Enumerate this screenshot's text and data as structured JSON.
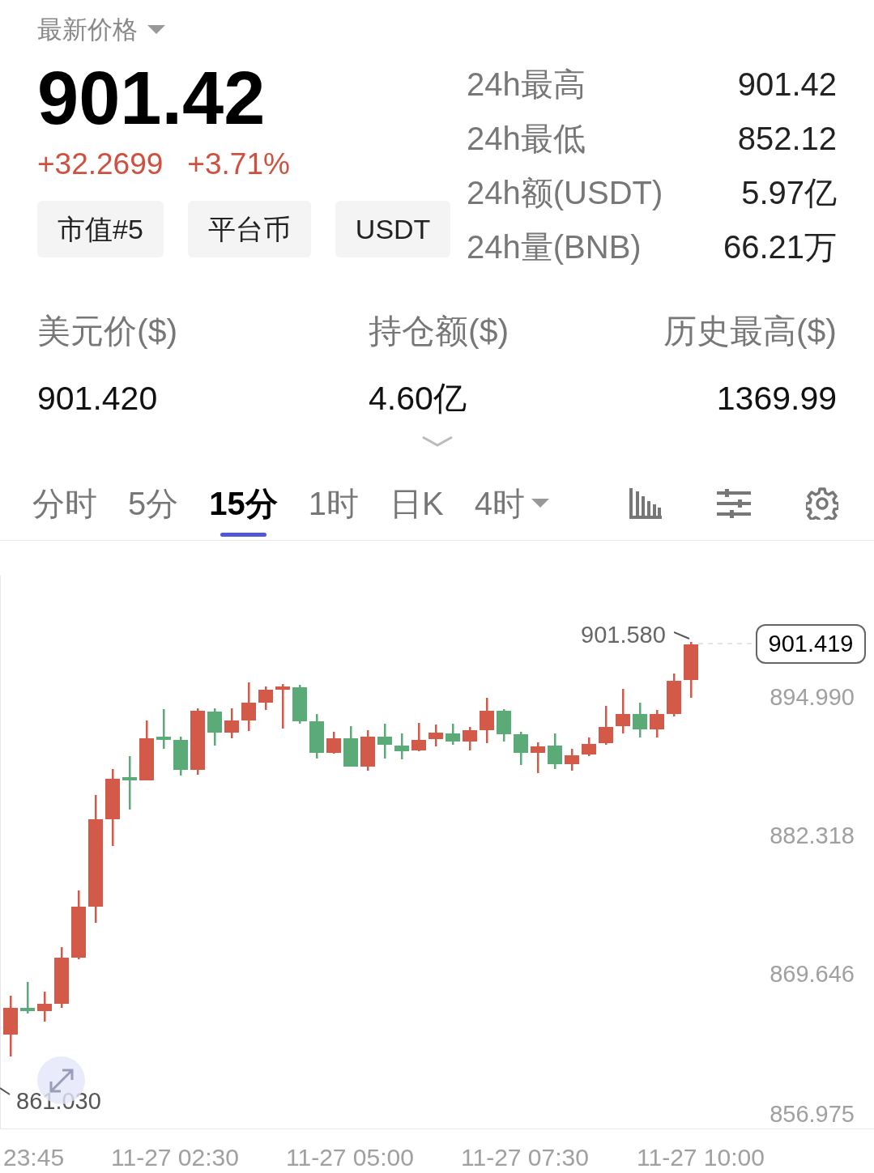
{
  "header": {
    "price_selector": "最新价格",
    "last_price": "901.42",
    "change": "+32.2699",
    "change_pct": "+3.71%",
    "tags": [
      "市值#5",
      "平台币",
      "USDT"
    ]
  },
  "stats_24h": [
    {
      "label": "24h最高",
      "value": "901.42"
    },
    {
      "label": "24h最低",
      "value": "852.12"
    },
    {
      "label": "24h额(USDT)",
      "value": "5.97亿"
    },
    {
      "label": "24h量(BNB)",
      "value": "66.21万"
    }
  ],
  "summary": [
    {
      "label": "美元价($)",
      "value": "901.420"
    },
    {
      "label": "持仓额($)",
      "value": "4.60亿"
    },
    {
      "label": "历史最高($)",
      "value": "1369.99"
    }
  ],
  "tabs": [
    {
      "label": "分时",
      "selected": false,
      "dropdown": false
    },
    {
      "label": "5分",
      "selected": false,
      "dropdown": false
    },
    {
      "label": "15分",
      "selected": true,
      "dropdown": false
    },
    {
      "label": "1时",
      "selected": false,
      "dropdown": false
    },
    {
      "label": "日K",
      "selected": false,
      "dropdown": false
    },
    {
      "label": "4时",
      "selected": false,
      "dropdown": true
    }
  ],
  "chart": {
    "y_axis_labels": [
      "894.990",
      "882.318",
      "869.646",
      "856.975"
    ],
    "current_price": "901.419",
    "high_marker": "901.580",
    "low_marker": "861.030",
    "x_axis_labels": [
      "23:45",
      "11-27 02:30",
      "11-27 05:00",
      "11-27 07:30",
      "11-27 10:00"
    ]
  }
}
